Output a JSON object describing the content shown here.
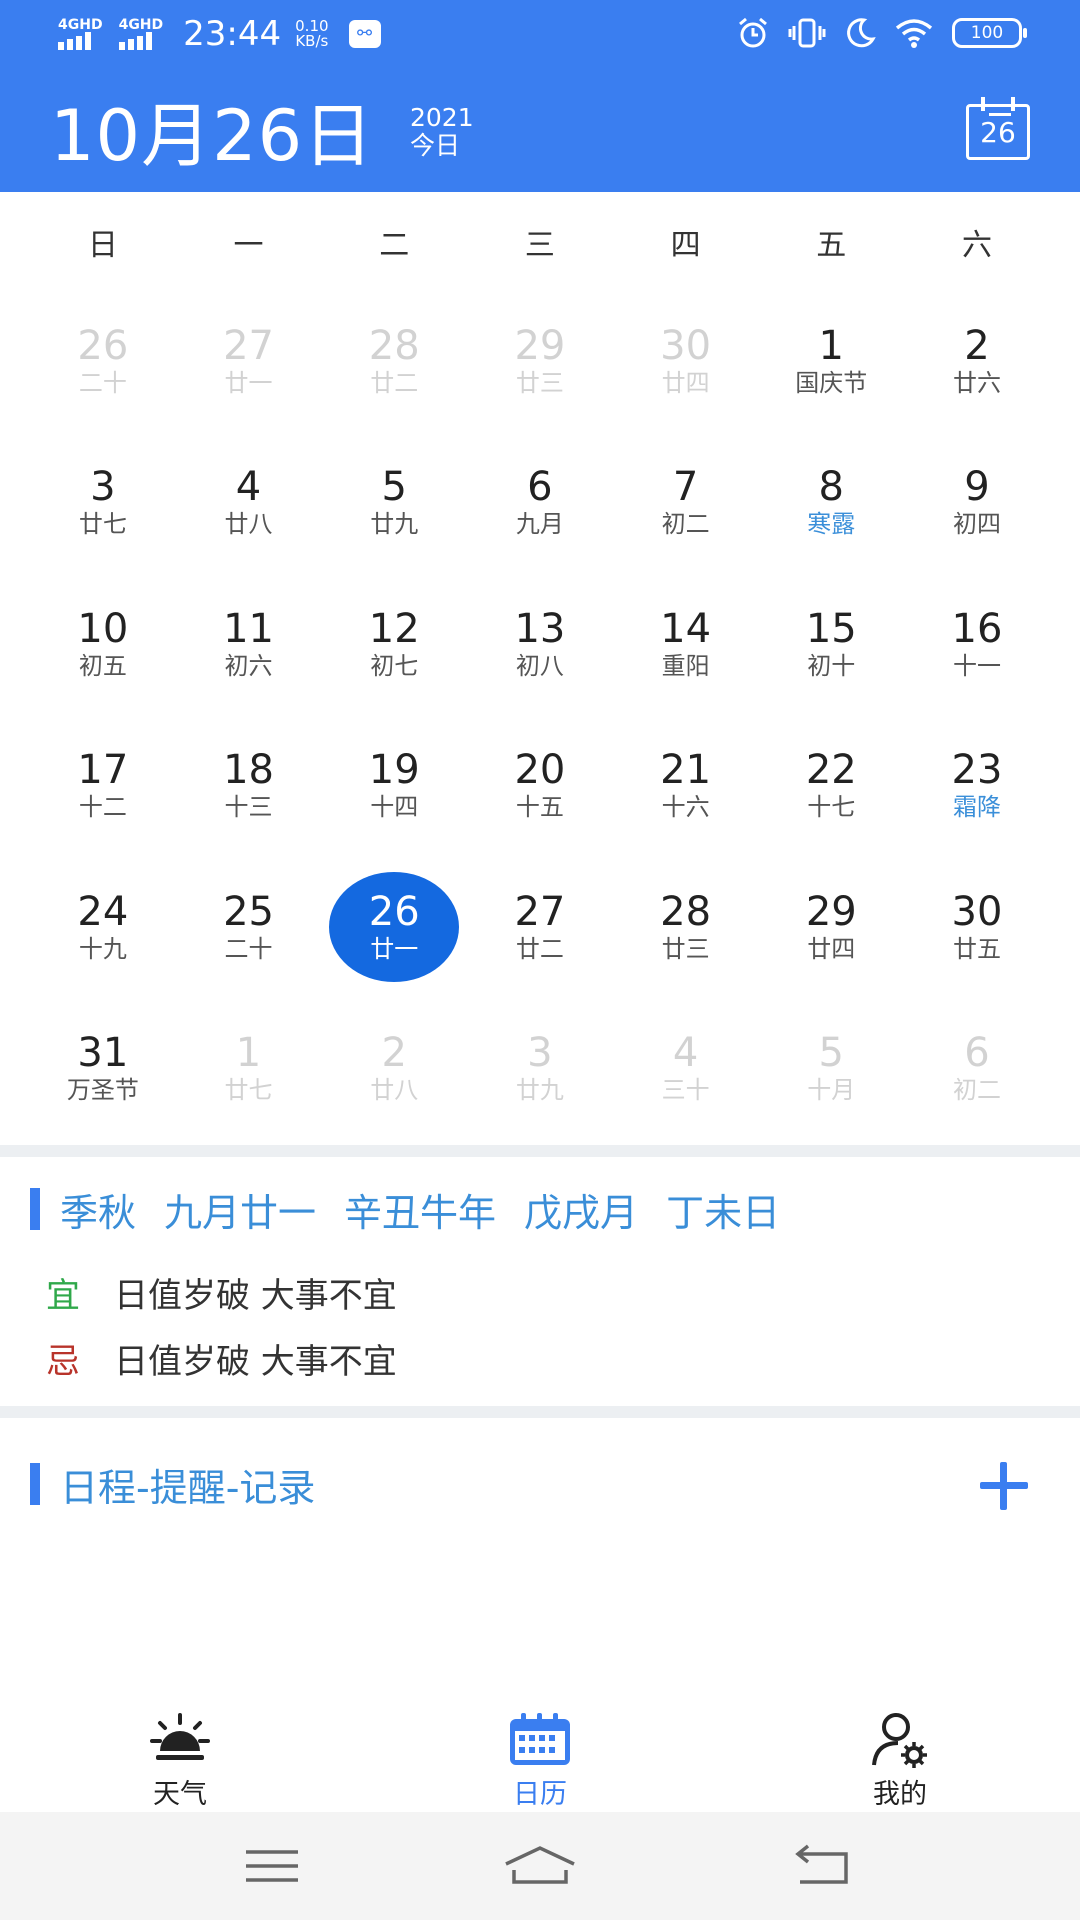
{
  "status_bar": {
    "sim1": "4GHD",
    "sim2": "4GHD",
    "time": "23:44",
    "speed_value": "0.10",
    "speed_unit": "KB/s",
    "battery": "100"
  },
  "header": {
    "date": "10月26日",
    "year": "2021",
    "today_label": "今日",
    "today_button_day": "26"
  },
  "weekdays": [
    "日",
    "一",
    "二",
    "三",
    "四",
    "五",
    "六"
  ],
  "calendar": {
    "weeks": [
      [
        {
          "day": "26",
          "lunar": "二十",
          "other": true
        },
        {
          "day": "27",
          "lunar": "廿一",
          "other": true
        },
        {
          "day": "28",
          "lunar": "廿二",
          "other": true
        },
        {
          "day": "29",
          "lunar": "廿三",
          "other": true
        },
        {
          "day": "30",
          "lunar": "廿四",
          "other": true
        },
        {
          "day": "1",
          "lunar": "国庆节"
        },
        {
          "day": "2",
          "lunar": "廿六"
        }
      ],
      [
        {
          "day": "3",
          "lunar": "廿七"
        },
        {
          "day": "4",
          "lunar": "廿八"
        },
        {
          "day": "5",
          "lunar": "廿九"
        },
        {
          "day": "6",
          "lunar": "九月"
        },
        {
          "day": "7",
          "lunar": "初二"
        },
        {
          "day": "8",
          "lunar": "寒露",
          "term": true
        },
        {
          "day": "9",
          "lunar": "初四"
        }
      ],
      [
        {
          "day": "10",
          "lunar": "初五"
        },
        {
          "day": "11",
          "lunar": "初六"
        },
        {
          "day": "12",
          "lunar": "初七"
        },
        {
          "day": "13",
          "lunar": "初八"
        },
        {
          "day": "14",
          "lunar": "重阳"
        },
        {
          "day": "15",
          "lunar": "初十"
        },
        {
          "day": "16",
          "lunar": "十一"
        }
      ],
      [
        {
          "day": "17",
          "lunar": "十二"
        },
        {
          "day": "18",
          "lunar": "十三"
        },
        {
          "day": "19",
          "lunar": "十四"
        },
        {
          "day": "20",
          "lunar": "十五"
        },
        {
          "day": "21",
          "lunar": "十六"
        },
        {
          "day": "22",
          "lunar": "十七"
        },
        {
          "day": "23",
          "lunar": "霜降",
          "term": true
        }
      ],
      [
        {
          "day": "24",
          "lunar": "十九"
        },
        {
          "day": "25",
          "lunar": "二十"
        },
        {
          "day": "26",
          "lunar": "廿一",
          "selected": true
        },
        {
          "day": "27",
          "lunar": "廿二"
        },
        {
          "day": "28",
          "lunar": "廿三"
        },
        {
          "day": "29",
          "lunar": "廿四"
        },
        {
          "day": "30",
          "lunar": "廿五"
        }
      ],
      [
        {
          "day": "31",
          "lunar": "万圣节"
        },
        {
          "day": "1",
          "lunar": "廿七",
          "other": true
        },
        {
          "day": "2",
          "lunar": "廿八",
          "other": true
        },
        {
          "day": "3",
          "lunar": "廿九",
          "other": true
        },
        {
          "day": "4",
          "lunar": "三十",
          "other": true
        },
        {
          "day": "5",
          "lunar": "十月",
          "other": true
        },
        {
          "day": "6",
          "lunar": "初二",
          "other": true
        }
      ]
    ]
  },
  "lunar_info": {
    "season": "季秋",
    "lunar_date": "九月廿一",
    "year_ganzhi": "辛丑牛年",
    "month_ganzhi": "戊戌月",
    "day_ganzhi": "丁未日",
    "yi_label": "宜",
    "yi_text": "日值岁破 大事不宜",
    "ji_label": "忌",
    "ji_text": "日值岁破 大事不宜"
  },
  "schedule": {
    "title": "日程-提醒-记录"
  },
  "tabs": [
    {
      "label": "天气",
      "icon": "weather-icon"
    },
    {
      "label": "日历",
      "icon": "calendar-icon",
      "active": true
    },
    {
      "label": "我的",
      "icon": "user-settings-icon"
    }
  ],
  "colors": {
    "primary": "#3a7ef0",
    "selected": "#1469e0",
    "solar_term": "#3b8fd9",
    "yi": "#2fa84a",
    "ji": "#b8332a"
  }
}
